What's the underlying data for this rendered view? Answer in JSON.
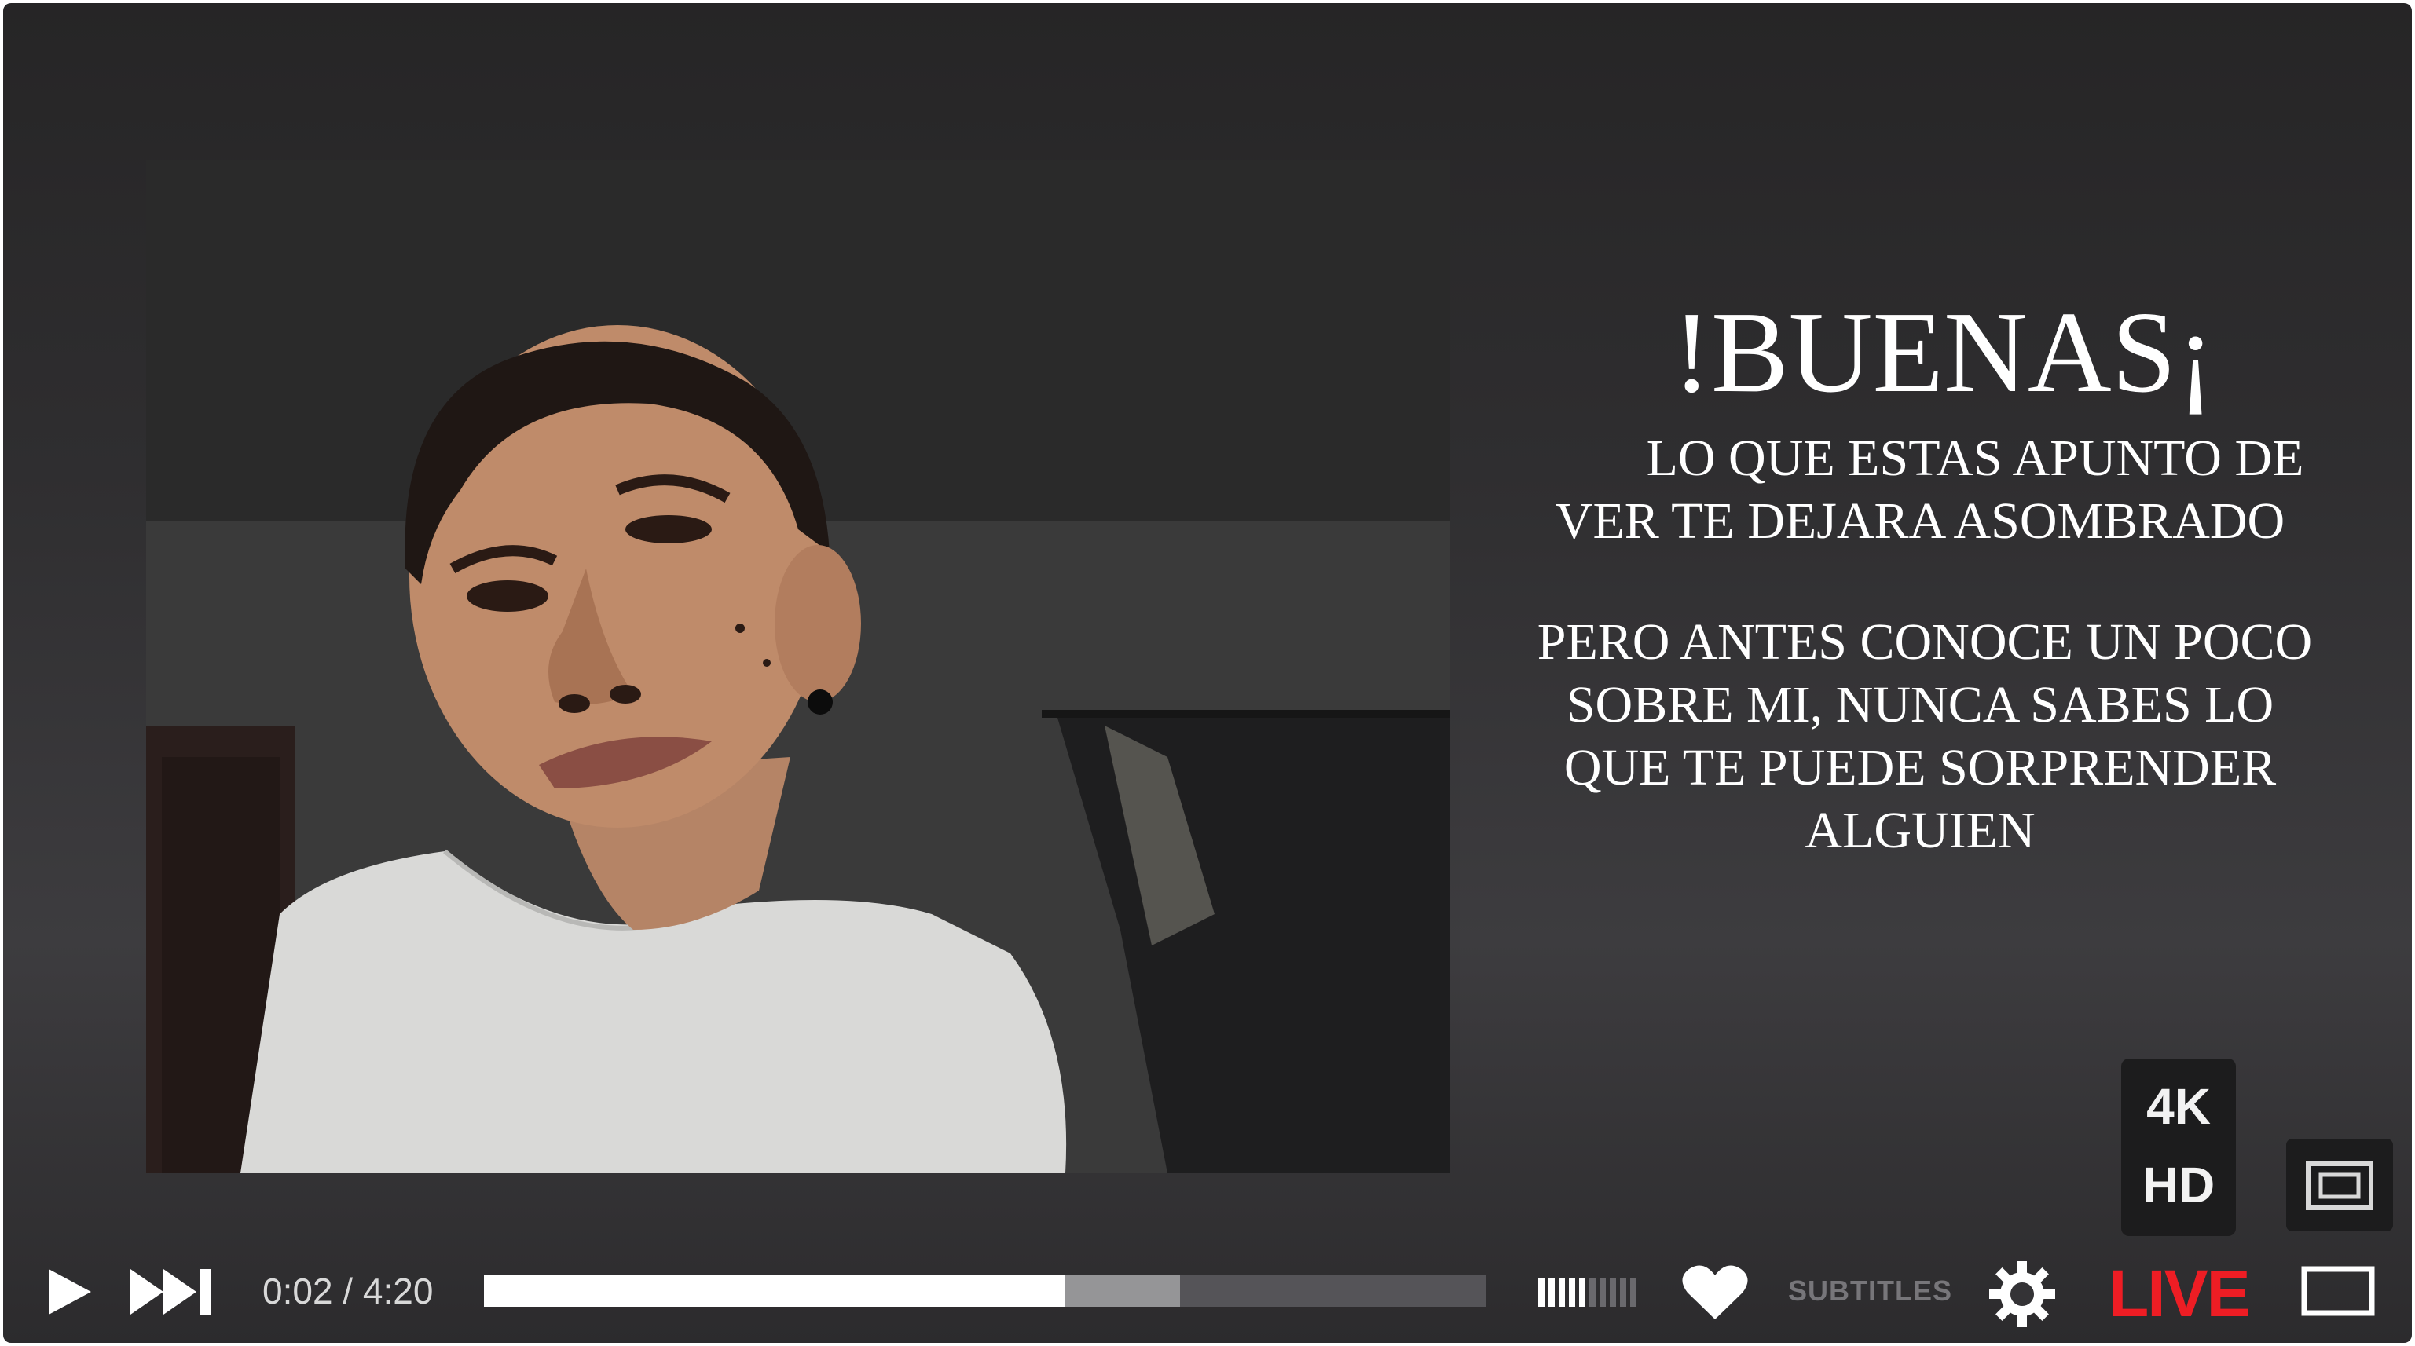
{
  "video": {
    "title": "!BUENAS¡",
    "lines_a": [
      "LO QUE ESTAS APUNTO DE",
      "VER TE DEJARA ASOMBRADO"
    ],
    "lines_b": [
      "PERO ANTES CONOCE UN POCO",
      "SOBRE MI, NUNCA SABES LO",
      "QUE TE PUEDE SORPRENDER",
      "ALGUIEN"
    ]
  },
  "controls": {
    "time": "0:02 / 4:20",
    "progress_played_fraction": 0.58,
    "progress_buffered_fraction": 0.694,
    "subtitles_label": "SUBTITLES",
    "live_label": "LIVE",
    "quality_4k": "4K",
    "quality_hd": "HD",
    "volume_level_fraction": 0.5,
    "accent_color": "#ee1d24",
    "icons": [
      "play-icon",
      "skip-next-icon",
      "volume-icon",
      "heart-icon",
      "settings-gear-icon",
      "picture-in-picture-icon",
      "fullscreen-icon"
    ]
  }
}
